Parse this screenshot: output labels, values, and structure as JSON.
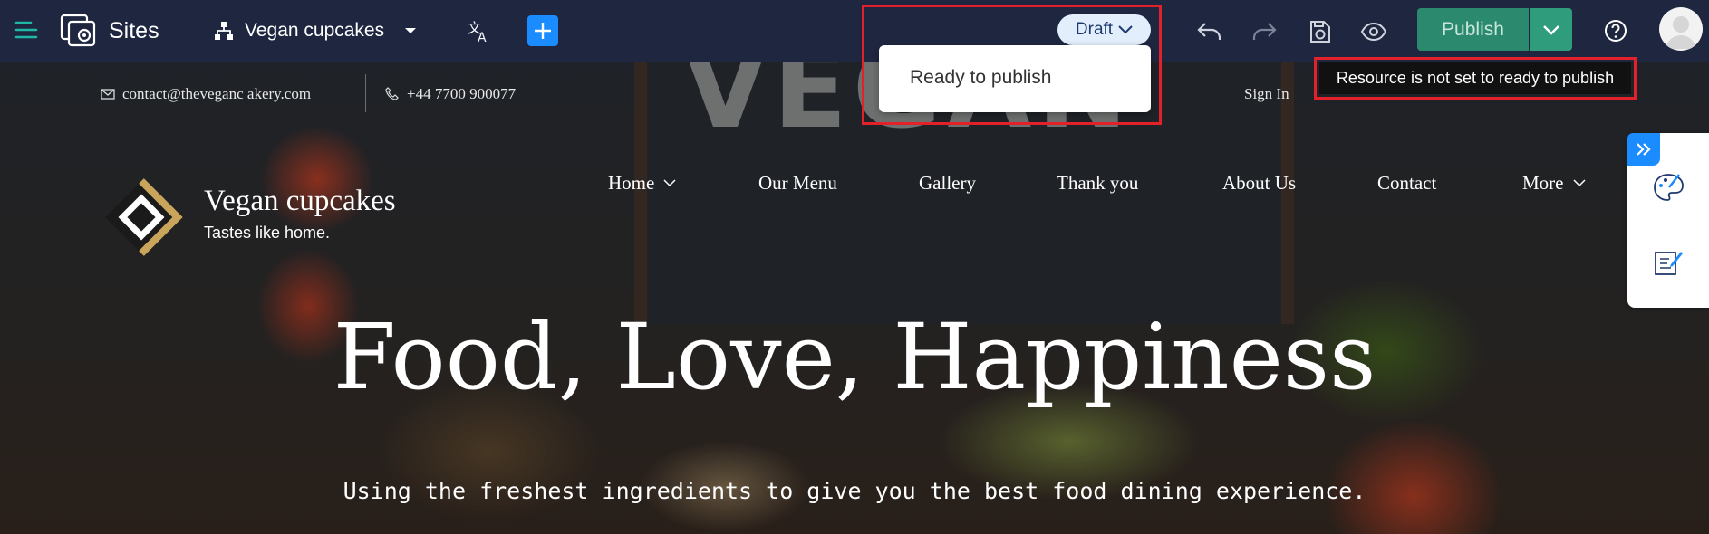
{
  "topbar": {
    "app_name": "Sites",
    "site_name": "Vegan cupcakes",
    "status_label": "Draft",
    "publish_label": "Publish",
    "status_menu": {
      "options": [
        "Ready to publish"
      ]
    },
    "tooltip": "Resource is not set to ready to publish"
  },
  "site": {
    "email": "contact@theveganc akery.com",
    "phone": "+44 7700 900077",
    "sign_in": "Sign In",
    "brand_name": "Vegan cupcakes",
    "tagline": "Tastes like home.",
    "nav": [
      "Home",
      "Our Menu",
      "Gallery",
      "Thank you",
      "About Us",
      "Contact",
      "More"
    ],
    "hero_title": "Food, Love, Happiness",
    "hero_subtitle": "Using the freshest ingredients to give you the best food dining experience.",
    "chalkboard_text": "VEGAN"
  },
  "colors": {
    "topbar_bg": "#1f2640",
    "accent_blue": "#1a8cff",
    "publish_green": "#2b8a6e",
    "highlight_red": "#e3212b",
    "brand_gold": "#c9a55b"
  }
}
